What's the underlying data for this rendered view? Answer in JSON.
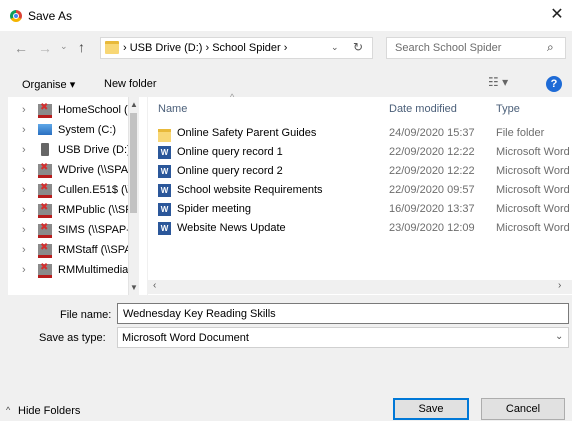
{
  "window": {
    "title": "Save As",
    "close_glyph": "✕"
  },
  "nav": {
    "back_glyph": "←",
    "forward_glyph": "→",
    "recent_glyph": "⌄",
    "up_glyph": "↑",
    "address": "›  USB Drive (D:)  ›  School Spider  ›",
    "address_dropdown_glyph": "⌄",
    "refresh_glyph": "↻",
    "search_placeholder": "Search School Spider",
    "search_icon": "⌕"
  },
  "toolbar": {
    "organise_label": "Organise ▾",
    "new_folder_label": "New folder",
    "view_glyph": "☷ ▾",
    "help_label": "?"
  },
  "sidebar": {
    "items": [
      {
        "label": "HomeSchool (\\",
        "icon": "network-drive-disconnected-icon"
      },
      {
        "label": "System (C:)",
        "icon": "computer-drive-icon"
      },
      {
        "label": "USB Drive (D:)",
        "icon": "usb-drive-icon"
      },
      {
        "label": "WDrive (\\\\SPAF",
        "icon": "network-drive-disconnected-icon"
      },
      {
        "label": "Cullen.E51$ (\\\\",
        "icon": "network-drive-disconnected-icon"
      },
      {
        "label": "RMPublic (\\\\SF",
        "icon": "network-drive-disconnected-icon"
      },
      {
        "label": "SIMS (\\\\SPAP-S",
        "icon": "network-drive-disconnected-icon"
      },
      {
        "label": "RMStaff (\\\\SPA",
        "icon": "network-drive-disconnected-icon"
      },
      {
        "label": "RMMultimedia",
        "icon": "network-drive-disconnected-icon"
      }
    ],
    "chevron_glyph": "›"
  },
  "columns": {
    "name": "Name",
    "date": "Date modified",
    "type": "Type",
    "sort_glyph": "^"
  },
  "files": [
    {
      "name": "Online Safety Parent Guides",
      "date": "24/09/2020 15:37",
      "type": "File folder",
      "kind": "folder"
    },
    {
      "name": "Online query record 1",
      "date": "22/09/2020 12:22",
      "type": "Microsoft Word",
      "kind": "word"
    },
    {
      "name": "Online query record 2",
      "date": "22/09/2020 12:22",
      "type": "Microsoft Word",
      "kind": "word"
    },
    {
      "name": "School website Requirements",
      "date": "22/09/2020 09:57",
      "type": "Microsoft Word",
      "kind": "word"
    },
    {
      "name": "Spider meeting",
      "date": "16/09/2020 13:37",
      "type": "Microsoft Word",
      "kind": "word"
    },
    {
      "name": "Website News Update",
      "date": "23/09/2020 12:09",
      "type": "Microsoft Word",
      "kind": "word"
    }
  ],
  "form": {
    "file_name_label": "File name:",
    "file_name_value": "Wednesday Key Reading Skills",
    "save_type_label": "Save as type:",
    "save_type_value": "Microsoft Word Document"
  },
  "footer": {
    "hide_folders_label": "Hide Folders",
    "hide_glyph": "^",
    "save_label": "Save",
    "cancel_label": "Cancel"
  },
  "colors": {
    "accent": "#0078d7",
    "help": "#1e6bd6",
    "folder": "#f8d775",
    "word": "#2b579a"
  }
}
